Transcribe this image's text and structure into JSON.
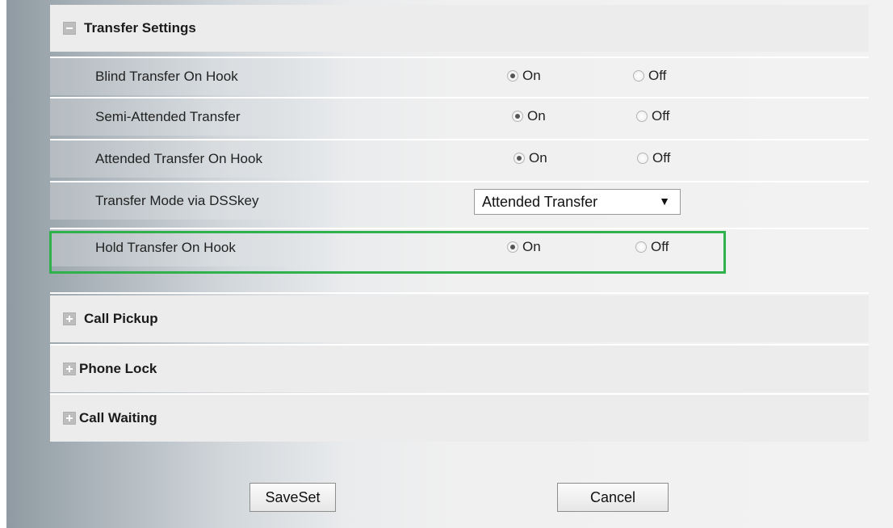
{
  "transfer_settings": {
    "title": "Transfer Settings",
    "rows": [
      {
        "label": "Blind Transfer On Hook",
        "on": "On",
        "off": "Off",
        "selected": "on"
      },
      {
        "label": "Semi-Attended Transfer",
        "on": "On",
        "off": "Off",
        "selected": "on"
      },
      {
        "label": "Attended Transfer On Hook",
        "on": "On",
        "off": "Off",
        "selected": "on"
      },
      {
        "label": "Transfer Mode via DSSkey",
        "select_value": "Attended Transfer"
      },
      {
        "label": "Hold Transfer On Hook",
        "on": "On",
        "off": "Off",
        "selected": "on"
      }
    ]
  },
  "sections": [
    {
      "title": "Call Pickup"
    },
    {
      "title": "Phone Lock"
    },
    {
      "title": "Call Waiting"
    }
  ],
  "buttons": {
    "save": "SaveSet",
    "cancel": "Cancel"
  },
  "colors": {
    "highlight": "#2fb24c"
  },
  "icons": {
    "collapse": "minus-icon",
    "expand": "plus-icon",
    "dropdown": "chevron-down-icon"
  }
}
